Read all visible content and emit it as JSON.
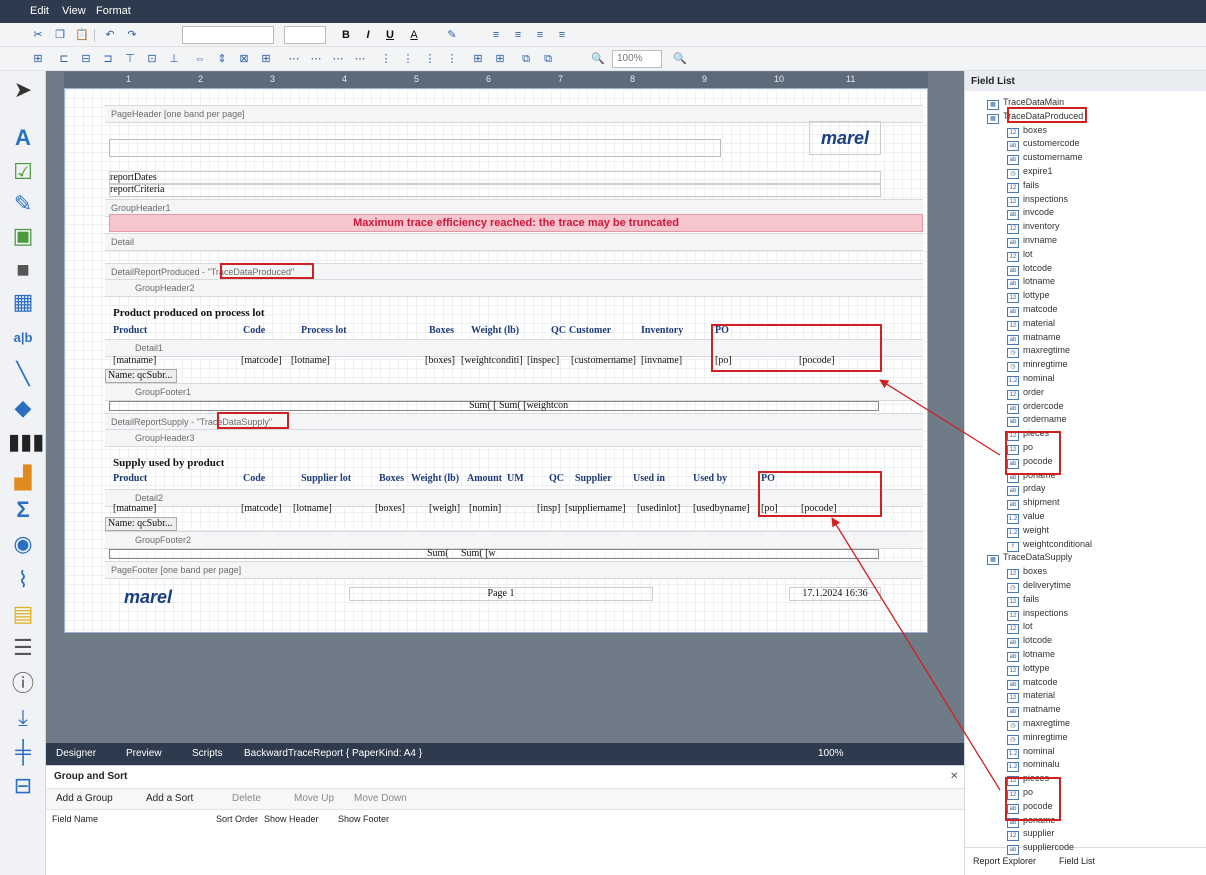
{
  "menu": [
    "Edit",
    "View",
    "Format"
  ],
  "toolbar": {
    "font_size": "",
    "zoom": "100%",
    "bold": "B",
    "italic": "I",
    "underline": "U",
    "font_color": "A"
  },
  "bands": {
    "page_header": "PageHeader [one band per page]",
    "group_header1": "GroupHeader1",
    "detail": "Detail",
    "detail_report_produced": "DetailReportProduced - \"TraceDataProduced\"",
    "group_header2": "GroupHeader2",
    "detail1": "Detail1",
    "group_footer1": "GroupFooter1",
    "detail_report_supply": "DetailReportSupply - \"TraceDataSupply\"",
    "group_header3": "GroupHeader3",
    "detail2": "Detail2",
    "group_footer2": "GroupFooter2",
    "page_footer": "PageFooter [one band per page]"
  },
  "report": {
    "report_dates": "reportDates",
    "report_criteria": "reportCriteria",
    "warning": "Maximum trace efficiency reached: the trace may be truncated",
    "produced_title": "Product produced on process lot",
    "produced_headers": [
      "Product",
      "Code",
      "Process lot",
      "Boxes",
      "Weight (lb)",
      "QC",
      "Customer",
      "Inventory",
      "PO"
    ],
    "produced_fields": [
      "[matname]",
      "[matcode]",
      "[lotname]",
      "[boxes]",
      "[weightconditi]",
      "[inspec]",
      "[customername]",
      "[invname]",
      "[po]",
      "[pocode]"
    ],
    "subreport_name1": "Name: qcSubr...",
    "sum1": "Sum( [",
    "sum2": "Sum( [weightcon",
    "supply_title": "Supply used by product",
    "supply_headers": [
      "Product",
      "Code",
      "Supplier lot",
      "Boxes",
      "Weight (lb)",
      "Amount",
      "UM",
      "QC",
      "Supplier",
      "Used in",
      "Used by",
      "PO"
    ],
    "supply_fields": [
      "[matname]",
      "[matcode]",
      "[lotname]",
      "[boxes]",
      "[weigh]",
      "[nomin]",
      "[insp]",
      "[suppliername]",
      "[usedinlot]",
      "[usedbyname]",
      "[po]",
      "[pocode]"
    ],
    "subreport_name2": "Name: qcSubr...",
    "sum3": "Sum(",
    "sum4": "Sum( [w",
    "page_label": "Page 1",
    "date_label": "17.1.2024 16:36",
    "logo_text": "marel"
  },
  "bottom_tabs": {
    "designer": "Designer",
    "preview": "Preview",
    "scripts": "Scripts",
    "report_name": "BackwardTraceReport { PaperKind: A4 }",
    "zoom": "100%"
  },
  "group_sort": {
    "title": "Group and Sort",
    "add_group": "Add a Group",
    "add_sort": "Add a Sort",
    "delete": "Delete",
    "move_up": "Move Up",
    "move_down": "Move Down",
    "columns": [
      "Field Name",
      "Sort Order",
      "Show Header",
      "Show Footer"
    ]
  },
  "field_list": {
    "title": "Field List",
    "main": "TraceDataMain",
    "produced": "TraceDataProduced",
    "produced_fields": [
      {
        "t": "12",
        "n": "boxes"
      },
      {
        "t": "ab",
        "n": "customercode"
      },
      {
        "t": "ab",
        "n": "customername"
      },
      {
        "t": "◷",
        "n": "expire1"
      },
      {
        "t": "12",
        "n": "fails"
      },
      {
        "t": "12",
        "n": "inspections"
      },
      {
        "t": "ab",
        "n": "invcode"
      },
      {
        "t": "12",
        "n": "inventory"
      },
      {
        "t": "ab",
        "n": "invname"
      },
      {
        "t": "12",
        "n": "lot"
      },
      {
        "t": "ab",
        "n": "lotcode"
      },
      {
        "t": "ab",
        "n": "lotname"
      },
      {
        "t": "12",
        "n": "lottype"
      },
      {
        "t": "ab",
        "n": "matcode"
      },
      {
        "t": "12",
        "n": "material"
      },
      {
        "t": "ab",
        "n": "matname"
      },
      {
        "t": "◷",
        "n": "maxregtime"
      },
      {
        "t": "◷",
        "n": "minregtime"
      },
      {
        "t": "1.2",
        "n": "nominal"
      },
      {
        "t": "12",
        "n": "order"
      },
      {
        "t": "ab",
        "n": "ordercode"
      },
      {
        "t": "ab",
        "n": "ordername"
      },
      {
        "t": "12",
        "n": "pieces"
      },
      {
        "t": "12",
        "n": "po"
      },
      {
        "t": "ab",
        "n": "pocode"
      },
      {
        "t": "ab",
        "n": "poname"
      },
      {
        "t": "ab",
        "n": "prday"
      },
      {
        "t": "ab",
        "n": "shipment"
      },
      {
        "t": "1.2",
        "n": "value"
      },
      {
        "t": "1.2",
        "n": "weight"
      },
      {
        "t": "f",
        "n": "weightconditional"
      }
    ],
    "supply": "TraceDataSupply",
    "supply_fields": [
      {
        "t": "12",
        "n": "boxes"
      },
      {
        "t": "◷",
        "n": "deliverytime"
      },
      {
        "t": "12",
        "n": "fails"
      },
      {
        "t": "12",
        "n": "inspections"
      },
      {
        "t": "12",
        "n": "lot"
      },
      {
        "t": "ab",
        "n": "lotcode"
      },
      {
        "t": "ab",
        "n": "lotname"
      },
      {
        "t": "12",
        "n": "lottype"
      },
      {
        "t": "ab",
        "n": "matcode"
      },
      {
        "t": "12",
        "n": "material"
      },
      {
        "t": "ab",
        "n": "matname"
      },
      {
        "t": "◷",
        "n": "maxregtime"
      },
      {
        "t": "◷",
        "n": "minregtime"
      },
      {
        "t": "1.2",
        "n": "nominal"
      },
      {
        "t": "1.2",
        "n": "nominalu"
      },
      {
        "t": "12",
        "n": "pieces"
      },
      {
        "t": "12",
        "n": "po"
      },
      {
        "t": "ab",
        "n": "pocode"
      },
      {
        "t": "ab",
        "n": "poname"
      },
      {
        "t": "12",
        "n": "supplier"
      },
      {
        "t": "ab",
        "n": "suppliercode"
      }
    ],
    "report_explorer": "Report Explorer",
    "field_list_tab": "Field List"
  },
  "accent": "#d21f1f"
}
